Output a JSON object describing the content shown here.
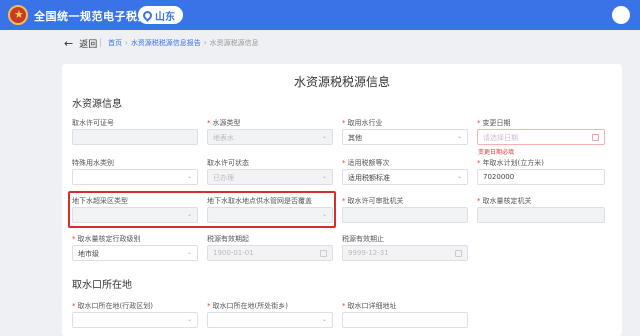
{
  "header": {
    "app_title": "全国统一规范电子税务局",
    "region": "山东",
    "icons": {
      "logo": "national-emblem-icon",
      "region": "location-pin-icon",
      "avatar": "user-avatar-icon"
    }
  },
  "nav": {
    "back_label": "返回",
    "breadcrumb": [
      "首页",
      "水资源税税源信息报告",
      "水资源税源信息"
    ]
  },
  "page": {
    "title": "水资源税税源信息",
    "section1_title": "水资源信息",
    "section2_title": "取水口所在地"
  },
  "fields": {
    "permit_no": {
      "label": "取水许可证号",
      "value": ""
    },
    "water_source_type": {
      "label": "水源类型",
      "value": "地表水"
    },
    "water_industry": {
      "label": "取用水行业",
      "value": "其他"
    },
    "change_date": {
      "label": "变更日期",
      "placeholder": "请选择日期",
      "error": "变更日期必填"
    },
    "special_water_type": {
      "label": "特殊用水类别",
      "value": ""
    },
    "permit_status": {
      "label": "取水许可状态",
      "value": "已办理"
    },
    "tax_level": {
      "label": "适用税额等次",
      "value": "适用税额标准"
    },
    "annual_plan": {
      "label": "年取水计划(立方米)",
      "value": "7020000"
    },
    "groundwater_zone": {
      "label": "地下水超采区类型",
      "value": ""
    },
    "pipe_network": {
      "label": "地下水取水地点供水管网是否覆盖",
      "value": ""
    },
    "approval_org": {
      "label": "取水许可审批机关",
      "value": ""
    },
    "verify_org": {
      "label": "取水量核定机关",
      "value": ""
    },
    "verify_level": {
      "label": "取水量核定行政级别",
      "value": "地市级"
    },
    "valid_from": {
      "label": "税源有效期起",
      "value": "1900-01-01"
    },
    "valid_to": {
      "label": "税源有效期止",
      "value": "9999-12-31"
    },
    "outlet_division": {
      "label": "取水口所在地(行政区划)"
    },
    "outlet_street": {
      "label": "取水口所在地(所处街乡)"
    },
    "outlet_address": {
      "label": "取水口详细地址"
    }
  },
  "colors": {
    "header": "#3a73e8",
    "highlight": "#d32f2f",
    "required": "#e23c3c"
  }
}
